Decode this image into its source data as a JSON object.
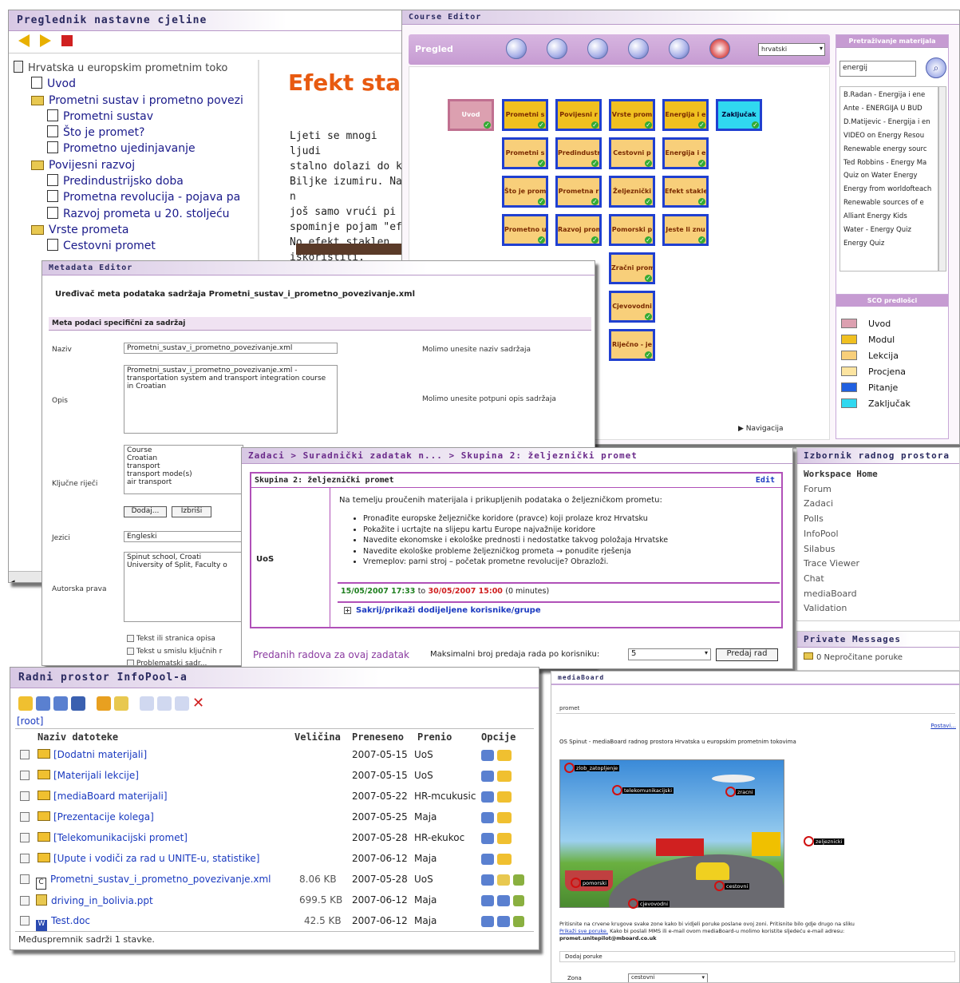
{
  "preglednik": {
    "title": "Preglednik nastavne cjeline",
    "heading": "Efekt stak",
    "body_lines": [
      "Ljeti se mnogi ljudi",
      "stalno dolazi do k",
      "Biljke izumiru. Na n",
      "još samo vrući pi",
      "spominje pojam \"ef",
      "No efekt staklen",
      "iskoristiti."
    ],
    "tree": [
      "Hrvatska u europskim prometnim toko",
      "Uvod",
      "Prometni sustav i prometno povezi",
      "Prometni sustav",
      "Što je promet?",
      "Prometno ujedinjavanje",
      "Povijesni razvoj",
      "Predindustrijsko doba",
      "Prometna revolucija - pojava pa",
      "Razvoj prometa u 20. stoljeću",
      "Vrste prometa",
      "Cestovni promet"
    ]
  },
  "course": {
    "title": "Course Editor",
    "tab": "Pregled",
    "lang": "hrvatski",
    "nav": "Navigacija",
    "search_title": "Pretraživanje materijala",
    "search_value": "energij",
    "results": [
      "B.Radan - Energija i ene",
      "Ante - ENERGIJA U BUD",
      "D.Matijevic - Energija i en",
      "VIDEO on Energy Resou",
      "Renewable energy sourc",
      "Ted Robbins - Energy Ma",
      "Quiz on Water Energy",
      "Energy from worldofteach",
      "Renewable sources of e",
      "Alliant Energy Kids",
      "Water - Energy Quiz",
      "Energy Quiz"
    ],
    "sco_title": "SCO predlošci",
    "legend": [
      "Uvod",
      "Modul",
      "Lekcija",
      "Procjena",
      "Pitanje",
      "Zaključak"
    ],
    "blocks": [
      "Uvod",
      "Prometni s",
      "Povijesni r",
      "Vrste prom",
      "Energija i e",
      "Zaključak",
      "Prometni s",
      "Predindustr",
      "Cestovni p",
      "Energija i e",
      "Što je prom",
      "Prometna r",
      "Željeznički",
      "Efekt stakle",
      "Prometno u",
      "Razvoj prom",
      "Pomorski p",
      "Jeste li znu",
      "Zračni prom",
      "Cjevovodni",
      "Riječno - je"
    ]
  },
  "meta": {
    "title": "Metadata Editor",
    "heading": "Uređivač meta podataka sadržaja Prometni_sustav_i_prometno_povezivanje.xml",
    "section": "Meta podaci specifični za sadržaj",
    "naziv_label": "Naziv",
    "naziv_value": "Prometni_sustav_i_prometno_povezivanje.xml",
    "naziv_hint": "Molimo unesite naziv sadržaja",
    "opis_label": "Opis",
    "opis_value": "Prometni_sustav_i_prometno_povezivanje.xml - transportation system and transport integration course in Croatian",
    "opis_hint": "Molimo unesite potpuni opis sadržaja",
    "kljucne_label": "Ključne riječi",
    "kljucne_value": "Course\nCroatian\ntransport\ntransport mode(s)\nair transport",
    "dodaj": "Dodaj...",
    "izbrisi": "Izbriši",
    "jezici_label": "Jezici",
    "jezici_value": "Engleski",
    "autor_label": "Autorska prava",
    "autor_value": "Spinut school, Croati\nUniversity of Split, Faculty o",
    "cb1": "Tekst ili stranica opisa",
    "cb2": "Tekst u smislu ključnih r",
    "cb3": "Problematski sadr..."
  },
  "task": {
    "breadcrumb": "Zadaci > Suradnički zadatak n... > Skupina 2: željeznički promet",
    "group_title": "Skupina 2: željeznički promet",
    "edit": "Edit",
    "row_label": "UoS",
    "intro": "Na temelju proučenih materijala i prikupljenih podataka o željezničkom prometu:",
    "bullets": [
      "Pronađite europske željezničke koridore (pravce) koji prolaze kroz Hrvatsku",
      "Pokažite i ucrtajte na slijepu kartu Europe najvažnije koridore",
      "Navedite ekonomske i ekološke prednosti i nedostatke takvog položaja Hrvatske",
      "Navedite ekološke probleme željezničkog prometa → ponudite rješenja",
      "Vremeplov: parni stroj – početak prometne revolucije? Obrazloži."
    ],
    "date_from": "15/05/2007 17:33",
    "to": "to",
    "date_to": "30/05/2007 15:00",
    "duration": "(0 minutes)",
    "toggle": "Sakrij/prikaži dodijeljene korisnike/grupe",
    "submitted": "Predanih radova za ovaj zadatak",
    "max_label": "Maksimalni broj predaja rada po korisniku:",
    "max_value": "5",
    "submit": "Predaj rad"
  },
  "izbornik": {
    "title": "Izbornik radnog prostora",
    "items": [
      "Workspace Home",
      "Forum",
      "Zadaci",
      "Polls",
      "InfoPool",
      "Silabus",
      "Trace Viewer",
      "Chat",
      "mediaBoard",
      "Validation"
    ]
  },
  "pm": {
    "title": "Private Messages",
    "unread": "0 Nepročitane poruke"
  },
  "infopool": {
    "title": "Radni prostor InfoPool-a",
    "root": "[root]",
    "headers": [
      "Naziv datoteke",
      "Veličina",
      "Preneseno",
      "Prenio",
      "Opcije"
    ],
    "rows": [
      [
        "[Dodatni materijali]",
        "",
        "2007-05-15",
        "UoS"
      ],
      [
        "[Materijali lekcije]",
        "",
        "2007-05-15",
        "UoS"
      ],
      [
        "[mediaBoard materijali]",
        "",
        "2007-05-22",
        "HR-mcukusic"
      ],
      [
        "[Prezentacije kolega]",
        "",
        "2007-05-25",
        "Maja"
      ],
      [
        "[Telekomunikacijski promet]",
        "",
        "2007-05-28",
        "HR-ekukoc"
      ],
      [
        "[Upute i vodiči za rad u UNITE-u, statistike]",
        "",
        "2007-06-12",
        "Maja"
      ],
      [
        "Prometni_sustav_i_prometno_povezivanje.xml",
        "8.06 KB",
        "2007-05-28",
        "UoS"
      ],
      [
        "driving_in_bolivia.ppt",
        "699.5 KB",
        "2007-06-12",
        "Maja"
      ],
      [
        "Test.doc",
        "42.5 KB",
        "2007-06-12",
        "Maja"
      ]
    ],
    "footer": "Međuspremnik sadrži 1 stavke."
  },
  "mediaboard": {
    "title": "mediaBoard",
    "tab": "promet",
    "link": "Postavi...",
    "caption": "OS Spinut - mediaBoard radnog prostora Hrvatska u europskim prometnim tokovima",
    "hotspots": [
      "zlob_zatopljenje",
      "telekomunikacijski",
      "zracni",
      "zeljeznicki",
      "pomorski",
      "cestovni",
      "cjevovodni"
    ],
    "p1": "Pritisnite na crvene krugove svake zone kako bi vidjeli poruke poslane ovoj zoni. Pritisnite bilo gdje drugo na sliku",
    "p1_link": "Prikaži sve poruke.",
    "p1_rest": "Kako bi poslali MMS ili e-mail ovom mediaBoard-u molimo koristite sljedeću e-mail adresu:",
    "email": "promet.unitepilot@mboard.co.uk",
    "add": "Dodaj poruke",
    "zona_label": "Zona",
    "zona_value": "cestovni"
  }
}
